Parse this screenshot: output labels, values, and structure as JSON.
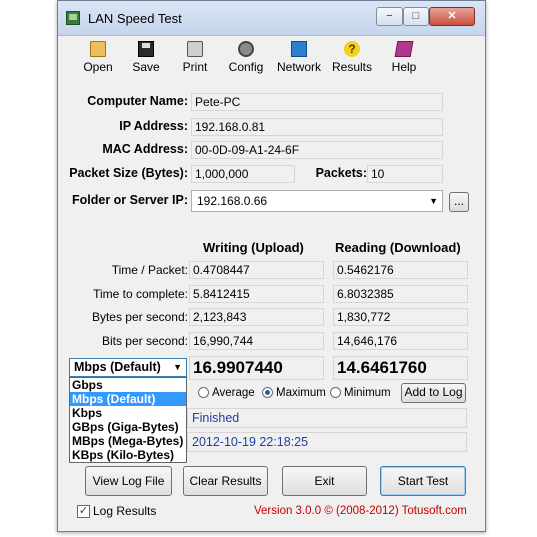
{
  "window": {
    "title": "LAN Speed Test",
    "min_glyph": "−",
    "max_glyph": "□",
    "close_glyph": "✕"
  },
  "toolbar": [
    {
      "label": "Open",
      "icon": "open-folder-icon"
    },
    {
      "label": "Save",
      "icon": "floppy-disk-icon"
    },
    {
      "label": "Print",
      "icon": "printer-icon"
    },
    {
      "label": "Config",
      "icon": "gear-icon"
    },
    {
      "label": "Network",
      "icon": "network-icon"
    },
    {
      "label": "Results",
      "icon": "question-icon"
    },
    {
      "label": "Help",
      "icon": "book-icon"
    }
  ],
  "info": {
    "computer_name_label": "Computer Name:",
    "computer_name": "Pete-PC",
    "ip_label": "IP Address:",
    "ip": "192.168.0.81",
    "mac_label": "MAC Address:",
    "mac": "00-0D-09-A1-24-6F",
    "packet_size_label": "Packet Size (Bytes):",
    "packet_size": "1,000,000",
    "packets_label": "Packets:",
    "packets": "10",
    "folder_label": "Folder or Server IP:",
    "folder": "192.168.0.66",
    "browse_label": "..."
  },
  "results": {
    "writing_header": "Writing (Upload)",
    "reading_header": "Reading (Download)",
    "rows": [
      {
        "label": "Time / Packet:",
        "write": "0.4708447",
        "read": "0.5462176"
      },
      {
        "label": "Time to complete:",
        "write": "5.8412415",
        "read": "6.8032385"
      },
      {
        "label": "Bytes per second:",
        "write": "2,123,843",
        "read": "1,830,772"
      },
      {
        "label": "Bits per second:",
        "write": "16,990,744",
        "read": "14,646,176"
      }
    ],
    "write_big": "16.9907440",
    "read_big": "14.6461760"
  },
  "units": {
    "selected": "Mbps (Default)",
    "options": [
      "Gbps",
      "Mbps (Default)",
      "Kbps",
      "GBps (Giga-Bytes)",
      "MBps (Mega-Bytes)",
      "KBps (Kilo-Bytes)"
    ]
  },
  "modes": {
    "average": "Average",
    "maximum": "Maximum",
    "minimum": "Minimum",
    "add_to_log": "Add to Log"
  },
  "status": {
    "line1": "Finished",
    "line2": "2012-10-19 22:18:25"
  },
  "buttons": {
    "view_log": "View Log File",
    "clear_results": "Clear Results",
    "exit": "Exit",
    "start_test": "Start Test"
  },
  "footer": {
    "log_results": "Log Results",
    "version": "Version 3.0.0  © (2008-2012) Totusoft.com"
  }
}
